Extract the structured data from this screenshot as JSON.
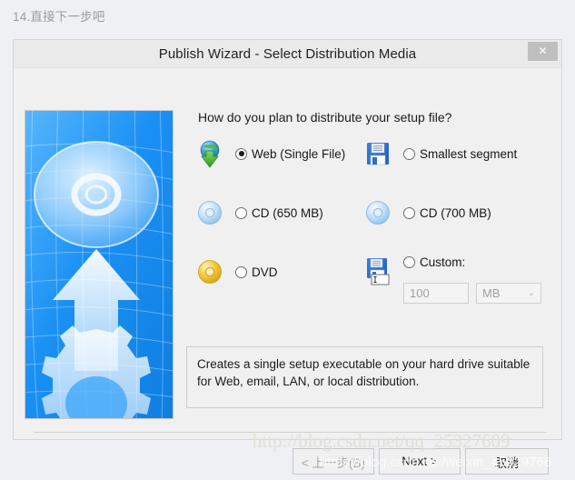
{
  "page": {
    "caption": "14.直接下一步吧"
  },
  "dialog": {
    "title": "Publish Wizard - Select Distribution Media",
    "close_label": "✕",
    "question": "How do you plan to distribute your setup file?"
  },
  "options": [
    {
      "id": "web",
      "icon": "globe-download-icon",
      "label": "Web (Single File)",
      "selected": true
    },
    {
      "id": "smallest-segment",
      "icon": "floppy-disk-icon",
      "label": "Smallest segment",
      "selected": false
    },
    {
      "id": "cd-650",
      "icon": "cd-disc-icon",
      "label": "CD (650 MB)",
      "selected": false
    },
    {
      "id": "cd-700",
      "icon": "cd-disc-icon",
      "label": "CD (700 MB)",
      "selected": false
    },
    {
      "id": "dvd",
      "icon": "dvd-disc-icon",
      "label": "DVD",
      "selected": false
    },
    {
      "id": "custom",
      "icon": "floppy-disk-custom-icon",
      "label": "Custom:",
      "selected": false
    }
  ],
  "custom_size": {
    "value": "100",
    "unit": "MB",
    "chevron": "⌄"
  },
  "description": {
    "text": "Creates a single setup executable on your hard drive suitable for Web, email, LAN, or local distribution."
  },
  "footer": {
    "back_label": "< 上一步(B)",
    "next_label": "Next >",
    "cancel_label": "取消"
  },
  "watermarks": {
    "serif": "http://blog.csdn.net/qq_25327609",
    "sans": "https://blog.csdn.net/weixin_45029766"
  },
  "colors": {
    "banner_blue": "#1b93f5",
    "dialog_bg": "#f0f0f0",
    "page_bg": "#eef0f3",
    "titlebar": "#eaeaea"
  }
}
